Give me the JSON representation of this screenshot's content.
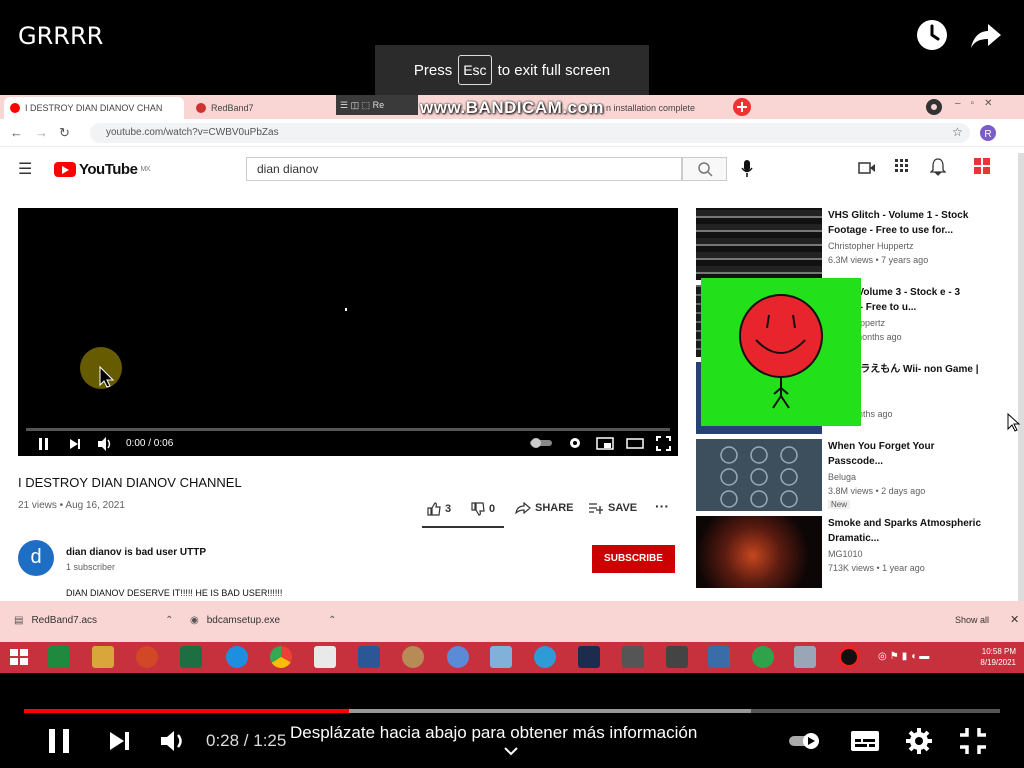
{
  "player": {
    "title": "GRRRR",
    "esc_prefix": "Press",
    "esc_key": "Esc",
    "esc_suffix": "to exit full screen",
    "time": "0:28 / 1:25",
    "scroll_hint": "Desplázate hacia abajo para obtener más información",
    "played_fraction": 0.333,
    "buffered_fraction": 0.745
  },
  "browser": {
    "tabs": [
      {
        "label": "I DESTROY DIAN DIANOV CHAN",
        "active": true
      },
      {
        "label": "RedBand7",
        "active": false
      },
      {
        "label": "n installation complete",
        "active": false
      }
    ],
    "recorder_overlay": "www.BANDICAM.com",
    "recorder_toolbar": "☰ ◫ ⬚ Re",
    "url": "youtube.com/watch?v=CWBV0uPbZas"
  },
  "youtube": {
    "logo_text": "YouTube",
    "region": "MX",
    "search_query": "dian dianov",
    "video": {
      "time": "0:00 / 0:06",
      "title": "I DESTROY DIAN DIANOV CHANNEL",
      "meta": "21 views • Aug 16, 2021",
      "likes": "3",
      "dislikes": "0",
      "share": "SHARE",
      "save": "SAVE"
    },
    "channel": {
      "avatar_letter": "d",
      "name": "dian dianov is bad user UTTP",
      "subscribers": "1 subscriber",
      "subscribe_label": "SUBSCRIBE",
      "description": "DIAN DIANOV DESERVE IT!!!!! HE IS BAD USER!!!!!!"
    },
    "recommendations": [
      {
        "title": "VHS Glitch - Volume 1 - Stock Footage - Free to use for...",
        "channel": "Christopher Huppertz",
        "meta": "6.3M views • 7 years ago",
        "badge": ""
      },
      {
        "title": "litch - Volume 3 - Stock e - 3 Hours - Free to u...",
        "channel": "pher Huppertz",
        "meta": "ws • 5 months ago",
        "badge": ""
      },
      {
        "title": "No1-ドラえもん Wii- non Game | A3...",
        "channel": "ect",
        "meta": "• 11 months ago",
        "badge": ""
      },
      {
        "title": "When You Forget Your Passcode...",
        "channel": "Beluga",
        "meta": "3.8M views • 2 days ago",
        "badge": "New"
      },
      {
        "title": "Smoke and Sparks Atmospheric Dramatic...",
        "channel": "MG1010",
        "meta": "713K views • 1 year ago",
        "badge": ""
      }
    ]
  },
  "downloads": {
    "items": [
      "RedBand7.acs",
      "bdcamsetup.exe"
    ],
    "show_all": "Show all"
  },
  "taskbar": {
    "time": "10:58 PM",
    "date": "8/19/2021"
  },
  "colors": {
    "youtube_red": "#ff0000",
    "subscribe_red": "#cc0000",
    "tab_bar_pink": "#f9d6d3",
    "taskbar_red": "#c7303d",
    "overlay_green": "#22e01a"
  }
}
